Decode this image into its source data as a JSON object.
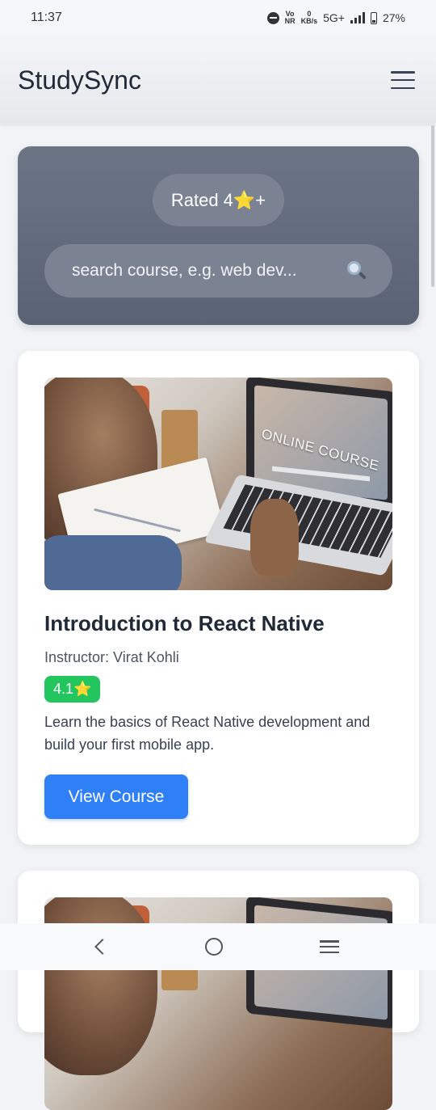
{
  "status_bar": {
    "time": "11:37",
    "volte_top": "Vo",
    "volte_bottom": "NR",
    "speed_value": "0",
    "speed_unit": "KB/s",
    "network": "5G+",
    "battery": "27%",
    "icons": [
      "do-not-disturb-icon",
      "signal-icon",
      "battery-icon"
    ]
  },
  "app_bar": {
    "title": "StudySync",
    "menu_icon": "hamburger-menu-icon"
  },
  "hero": {
    "rating_filter": "Rated 4⭐+",
    "search_placeholder": "search course, e.g. web dev...",
    "search_icon": "magnifier-icon"
  },
  "courses": [
    {
      "image_overlay_text": "ONLINE COURSE",
      "title": "Introduction to React Native",
      "instructor": "Instructor: Virat Kohli",
      "rating": "4.1⭐",
      "description": "Learn the basics of React Native development and build your first mobile app.",
      "button_label": "View Course",
      "rating_color": "#22c55e"
    }
  ],
  "colors": {
    "accent": "#2f7ff7",
    "hero_bg": "#636c7c",
    "rating_badge": "#22c55e"
  },
  "nav_bar": {
    "icons": [
      "back-icon",
      "home-icon",
      "recents-icon"
    ]
  }
}
